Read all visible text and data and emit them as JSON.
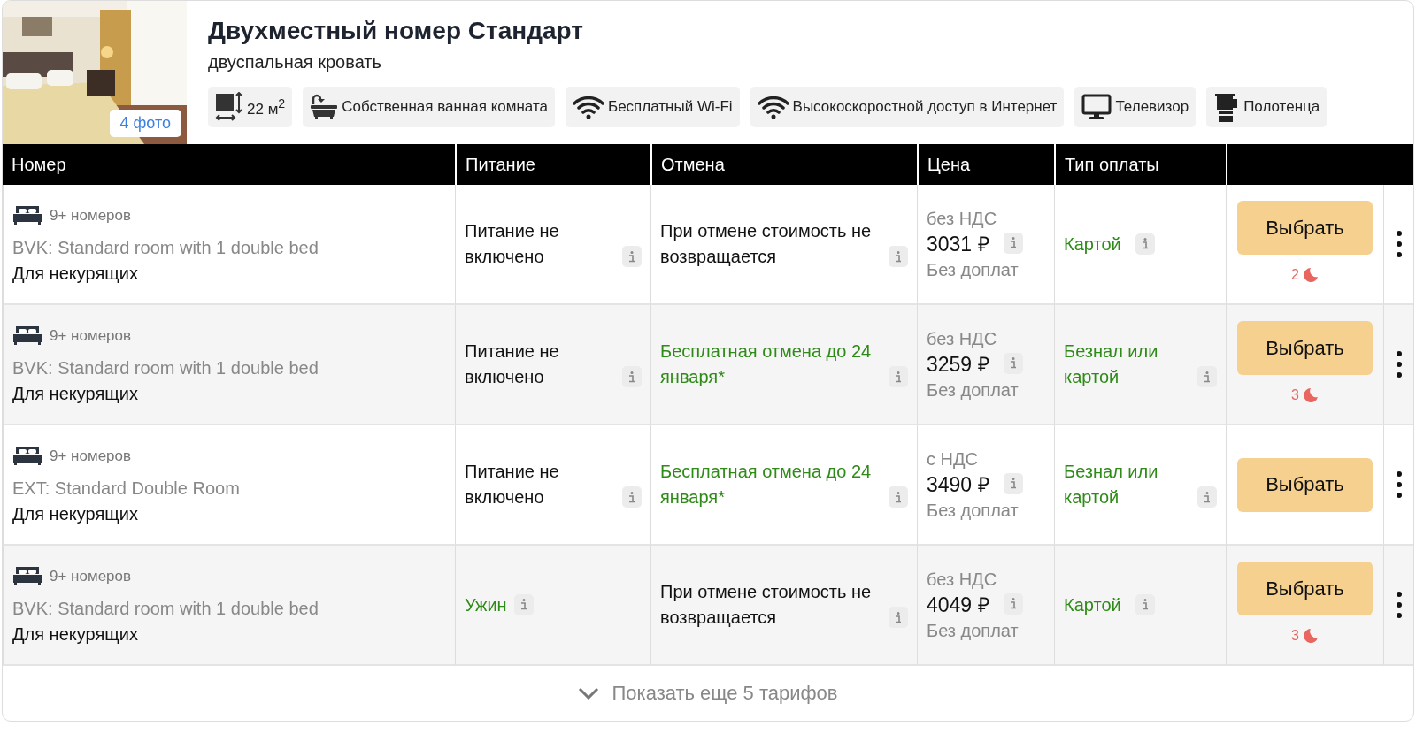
{
  "room": {
    "title": "Двухместный номер Стандарт",
    "subtitle": "двуспальная кровать",
    "photo_button": "4 фото",
    "amenities": [
      {
        "kind": "area",
        "label": "22 м$^{2}$"
      },
      {
        "kind": "bath",
        "label": "Собственная ванная комната"
      },
      {
        "kind": "wifi",
        "label": "Бесплатный Wi-Fi"
      },
      {
        "kind": "wifi",
        "label": "Высокоскоростной доступ в Интернет"
      },
      {
        "kind": "tv",
        "label": "Телевизор"
      },
      {
        "kind": "towel",
        "label": "Полотенца"
      }
    ]
  },
  "table": {
    "columns": [
      "Номер",
      "Питание",
      "Отмена",
      "Цена",
      "Тип оплаты"
    ],
    "rows": [
      {
        "availability": "9+ номеров",
        "room_name": "BVK: Standard room with 1 double bed",
        "note": "Для некурящих",
        "meal": {
          "text": "Питание не включено",
          "positive": false
        },
        "cancellation": {
          "text": "При отмене стоимость не возвращается",
          "positive": false
        },
        "vat": "без НДС",
        "price": "3031 ₽",
        "surcharge": "Без доплат",
        "payment": {
          "text": "Картой",
          "positive": true
        },
        "button": "Выбрать",
        "nights": "2"
      },
      {
        "availability": "9+ номеров",
        "room_name": "BVK: Standard room with 1 double bed",
        "note": "Для некурящих",
        "meal": {
          "text": "Питание не включено",
          "positive": false
        },
        "cancellation": {
          "text": "Бесплатная отмена до 24 января*",
          "positive": true
        },
        "vat": "без НДС",
        "price": "3259 ₽",
        "surcharge": "Без доплат",
        "payment": {
          "text": "Безнал или картой",
          "positive": true
        },
        "button": "Выбрать",
        "nights": "3"
      },
      {
        "availability": "9+ номеров",
        "room_name": "EXT: Standard Double Room",
        "note": "Для некурящих",
        "meal": {
          "text": "Питание не включено",
          "positive": false
        },
        "cancellation": {
          "text": "Бесплатная отмена до 24 января*",
          "positive": true
        },
        "vat": "с НДС",
        "price": "3490 ₽",
        "surcharge": "Без доплат",
        "payment": {
          "text": "Безнал или картой",
          "positive": true
        },
        "button": "Выбрать"
      },
      {
        "availability": "9+ номеров",
        "room_name": "BVK: Standard room with 1 double bed",
        "note": "Для некурящих",
        "meal": {
          "text": "Ужин",
          "positive": true
        },
        "cancellation": {
          "text": "При отмене стоимость не возвращается",
          "positive": false
        },
        "vat": "без НДС",
        "price": "4049 ₽",
        "surcharge": "Без доплат",
        "payment": {
          "text": "Картой",
          "positive": true
        },
        "button": "Выбрать",
        "nights": "3"
      }
    ]
  },
  "show_more": "Показать еще 5 тарифов"
}
